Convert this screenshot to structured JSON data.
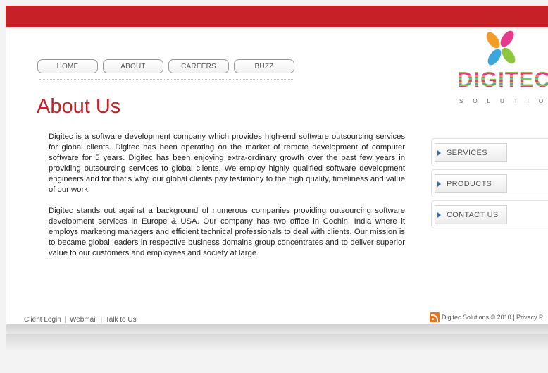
{
  "nav": {
    "items": [
      {
        "label": "HOME"
      },
      {
        "label": "ABOUT"
      },
      {
        "label": "CAREERS"
      },
      {
        "label": "BUZZ"
      }
    ]
  },
  "logo": {
    "word": "DIGITEC",
    "tagline": "SOLUTION"
  },
  "page": {
    "title": "About Us",
    "paragraphs": [
      "Digitec is a software development company which provides high-end software outsourcing services for global clients. Digitec has been operating on the market of remote development of computer software for 5 years. Digitec has been enjoying extra-ordinary growth over the past few years in providing outsourcing services to global clients. We employ highly qualified software development engineers and for that's why, our global clients pay testimony to the high quality, timeliness and value of our work.",
      "Digitec stands out against a background of numerous companies providing outsourcing software development services in Europe & USA. Our company has two office in Cochin, India where it employs marketing managers and efficient technical professionals to deal with clients. Our mission is to became global leaders in respective business domains group concentrates and to deliver superior value to our customers and employees and society at large."
    ]
  },
  "side_nav": {
    "items": [
      {
        "label": "SERVICES"
      },
      {
        "label": "PRODUCTS"
      },
      {
        "label": "CONTACT US"
      }
    ]
  },
  "footer": {
    "links": [
      "Client Login",
      "Webmail",
      "Talk to Us"
    ],
    "separator": "|",
    "right_text": "Digitec Solutions © 2010 | Privacy P"
  },
  "colors": {
    "brand_red": "#c52127",
    "rss_orange": "#e8731c"
  }
}
